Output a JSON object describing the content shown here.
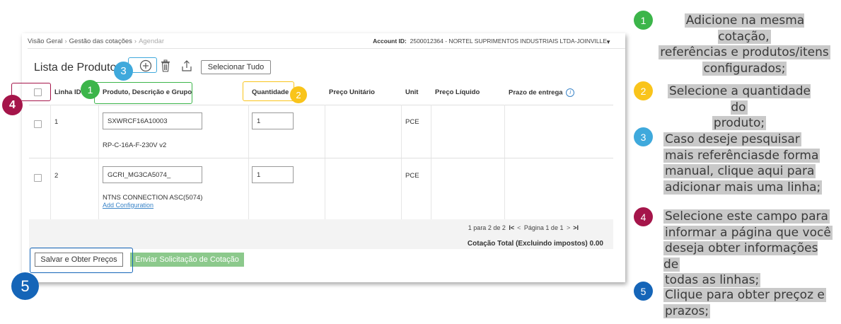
{
  "breadcrumb": [
    "Visão Geral",
    "Gestão das cotações",
    "Agendar"
  ],
  "account": {
    "label": "Account ID:",
    "value": "2500012364 - NORTEL SUPRIMENTOS INDUSTRIAIS LTDA-JOINVILLE"
  },
  "page_title": "Lista de Produto",
  "toolbar": {
    "add_icon": "plus-circle-icon",
    "delete_icon": "trash-icon",
    "upload_icon": "upload-icon",
    "select_all": "Selecionar Tudo"
  },
  "table": {
    "headers": [
      "Linha ID",
      "Produto, Descrição e Grupo",
      "Quantidade",
      "Preço Unitário",
      "Unit",
      "Preço Líquido",
      "Prazo de entrega"
    ],
    "info_icon_glyph": "i",
    "rows": [
      {
        "line_id": "1",
        "product_code": "SXWRCF16A10003",
        "description": "RP-C-16A-F-230V v2",
        "quantity": "1",
        "unit": "PCE",
        "link": ""
      },
      {
        "line_id": "2",
        "product_code": "GCRI_MG3CA5074_",
        "description": "NTNS CONNECTION ASC(5074)",
        "quantity": "1",
        "unit": "PCE",
        "link": "Add Configuration"
      }
    ]
  },
  "pagination": {
    "range": "1 para 2 de 2",
    "first": "I<",
    "prev": "<",
    "page_text": "Página 1 de 1",
    "next": ">",
    "last": ">I"
  },
  "total": "Cotação Total (Excluindo impostos) 0.00",
  "buttons": {
    "save": "Salvar e Obter Preços",
    "send": "Enviar Solicitação de Cotação"
  },
  "colors": {
    "green": "#3cb54a",
    "yellow": "#f9c41b",
    "lightblue": "#3fa9dc",
    "crimson": "#a5154a",
    "blue": "#1565b8"
  },
  "badges": [
    "1",
    "2",
    "3",
    "4",
    "5"
  ],
  "instructions": [
    {
      "num": "1",
      "color": "green",
      "lines": [
        "Adicione na mesma cotação,",
        "referências e produtos/itens",
        "configurados;"
      ]
    },
    {
      "num": "2",
      "color": "yellow",
      "lines": [
        "Selecione a quantidade do",
        "produto;"
      ]
    },
    {
      "num": "3",
      "color": "lightblue",
      "lines": [
        "Caso deseje pesquisar",
        "mais referênciasde forma",
        "manual, clique aqui para",
        "adicionar mais uma linha;"
      ]
    },
    {
      "num": "4",
      "color": "crimson",
      "lines": [
        "Selecione este campo para",
        "informar a página que você",
        "deseja obter informações de",
        "todas as linhas;"
      ]
    },
    {
      "num": "5",
      "color": "blue",
      "lines": [
        "Clique para obter preçoz e",
        "prazos;"
      ]
    }
  ]
}
